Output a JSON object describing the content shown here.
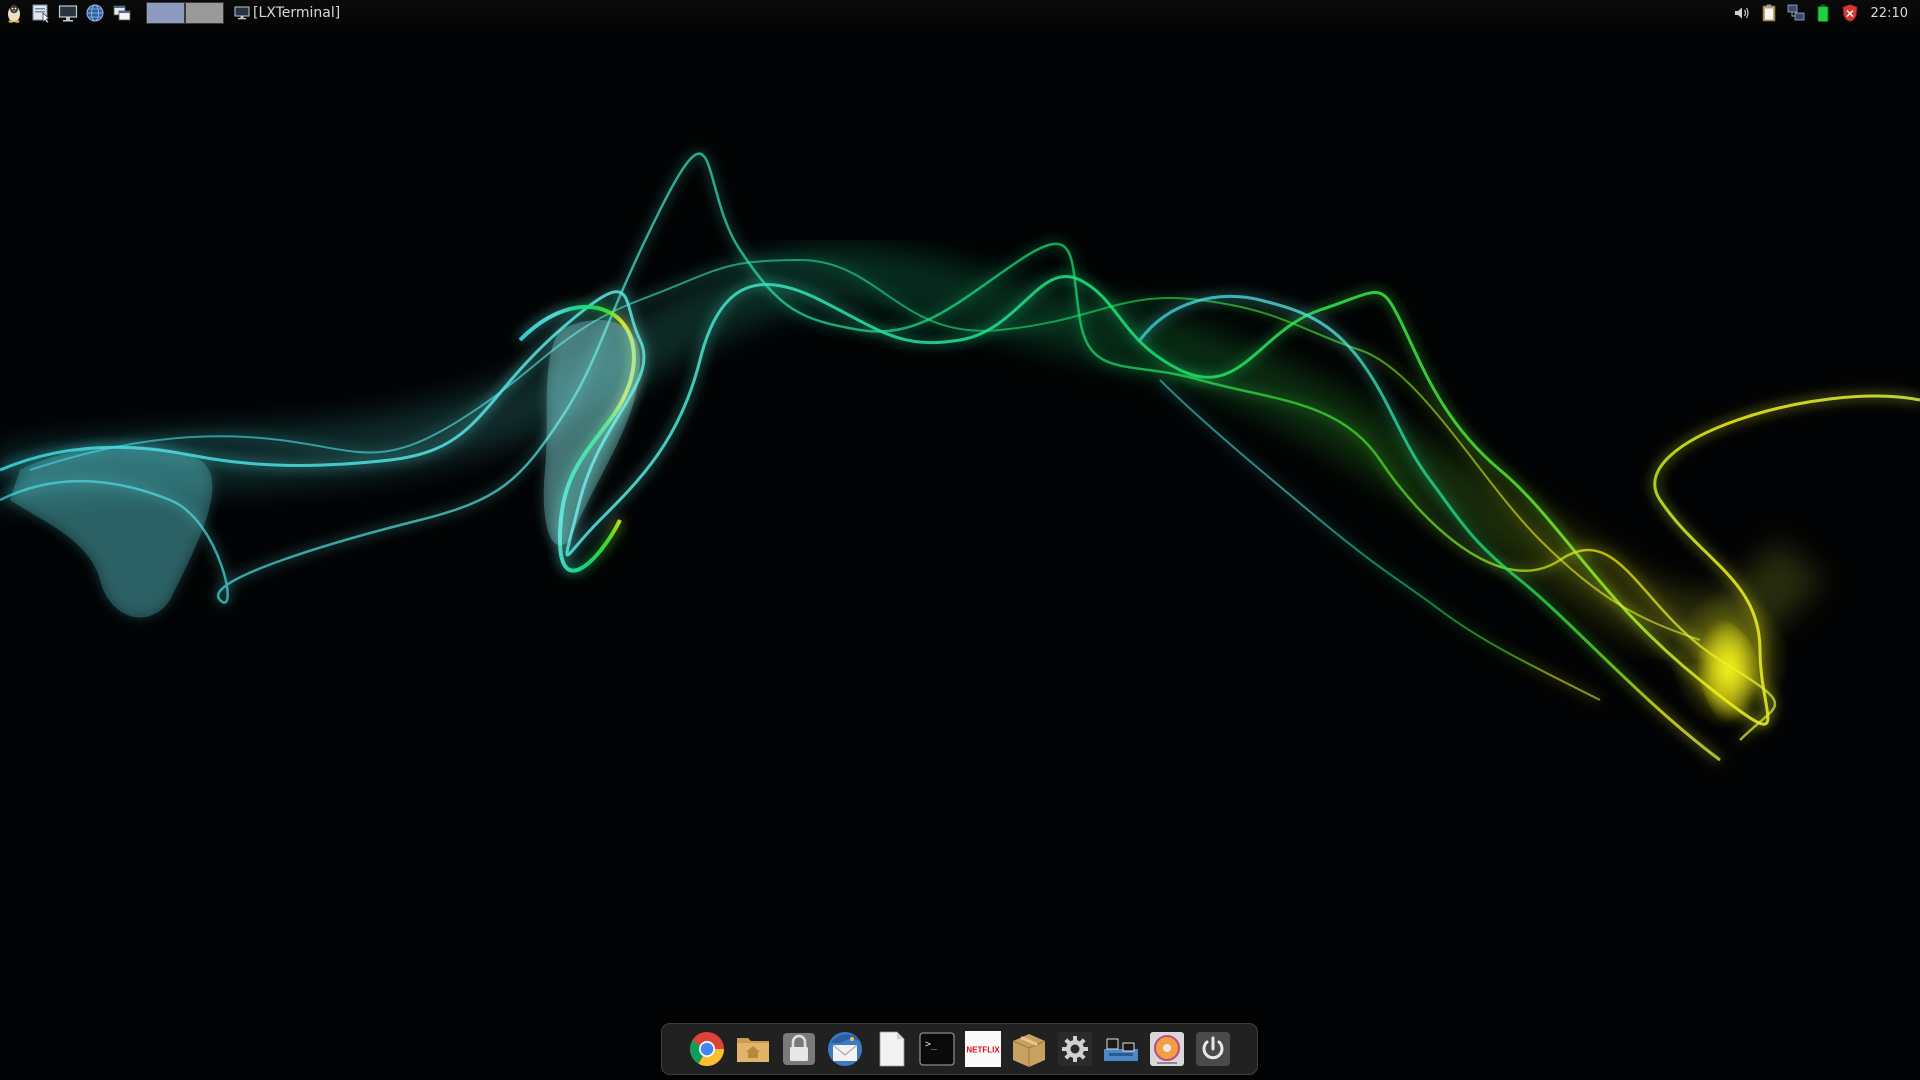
{
  "top_panel": {
    "launchers": [
      {
        "name": "menu-icon",
        "icon": "tux-penguin"
      },
      {
        "name": "file-manager-icon",
        "icon": "files-pointer"
      },
      {
        "name": "show-desktop-icon",
        "icon": "monitor"
      },
      {
        "name": "browser-launcher-icon",
        "icon": "globe"
      },
      {
        "name": "window-list-icon",
        "icon": "windows"
      }
    ],
    "pager": {
      "desktops": 2,
      "active": 1
    },
    "task": {
      "label": "[LXTerminal]",
      "icon": "terminal-monitor"
    },
    "tray": [
      {
        "name": "volume-icon"
      },
      {
        "name": "clipboard-icon"
      },
      {
        "name": "network-icon"
      },
      {
        "name": "battery-icon"
      },
      {
        "name": "shield-icon"
      }
    ],
    "clock": "22:10"
  },
  "dock": {
    "items": [
      {
        "name": "chrome-icon",
        "icon": "chrome"
      },
      {
        "name": "home-folder-icon",
        "icon": "home-folder"
      },
      {
        "name": "lock-icon",
        "icon": "padlock"
      },
      {
        "name": "thunderbird-icon",
        "icon": "thunderbird"
      },
      {
        "name": "text-editor-icon",
        "icon": "blank-document"
      },
      {
        "name": "terminal-icon",
        "icon": "terminal",
        "text": ">_"
      },
      {
        "name": "netflix-icon",
        "icon": "netflix",
        "text": "NETFLIX"
      },
      {
        "name": "archive-manager-icon",
        "icon": "package-box"
      },
      {
        "name": "settings-icon",
        "icon": "gear"
      },
      {
        "name": "network-manager-icon",
        "icon": "network-computers"
      },
      {
        "name": "disc-burner-icon",
        "icon": "cd-disc"
      },
      {
        "name": "power-icon",
        "icon": "power"
      }
    ]
  },
  "colors": {
    "panel_bg": "#070707",
    "wallpaper_cyan": "#35d6d9",
    "wallpaper_green": "#1ee88a",
    "wallpaper_yellow": "#f2f21a",
    "dock_bg": "#282828"
  }
}
